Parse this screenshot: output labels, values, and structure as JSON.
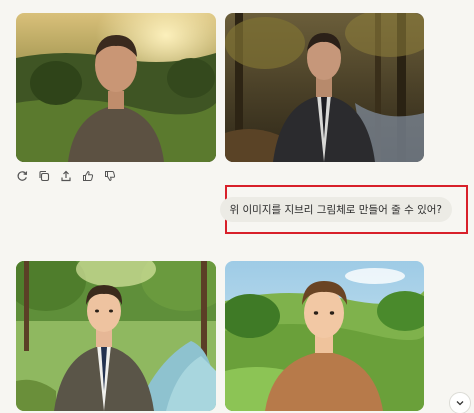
{
  "chat": {
    "user_message": "위 이미지를 지브리 그림체로 만들어 줄 수 있어?"
  },
  "images": {
    "original": [
      "photo-man-field-sunset",
      "photo-man-suit-forest-stream"
    ],
    "generated": [
      "ghibli-man-suit-river",
      "ghibli-man-meadow"
    ]
  },
  "actions": [
    "refresh-icon",
    "copy-icon",
    "share-icon",
    "thumbs-up-icon",
    "thumbs-down-icon"
  ],
  "colors": {
    "highlight_border": "#d8202a",
    "bubble_bg": "#ecebe5",
    "page_bg": "#f7f6f2"
  }
}
